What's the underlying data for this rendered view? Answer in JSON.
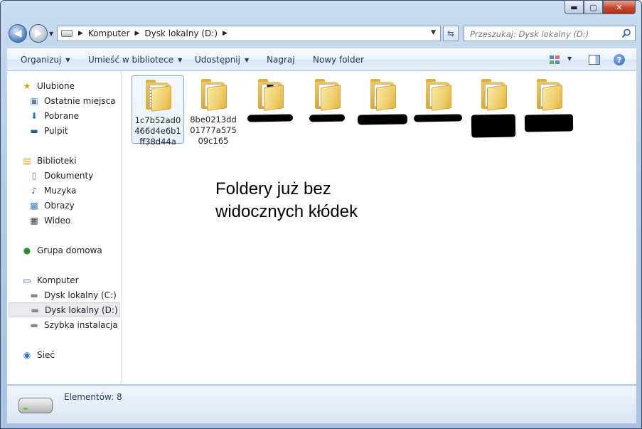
{
  "window": {
    "controls": {
      "minimize": "▬",
      "maximize": "▢",
      "close": "✕"
    }
  },
  "address": {
    "crumbs": [
      "Komputer",
      "Dysk lokalny (D:)"
    ],
    "search_placeholder": "Przeszukaj: Dysk lokalny (D:)"
  },
  "toolbar": {
    "organize": "Organizuj",
    "include_library": "Umieść w bibliotece",
    "share": "Udostępnij",
    "burn": "Nagraj",
    "new_folder": "Nowy folder"
  },
  "nav": {
    "favorites": "Ulubione",
    "recent": "Ostatnie miejsca",
    "downloads": "Pobrane",
    "desktop": "Pulpit",
    "libraries": "Biblioteki",
    "documents": "Dokumenty",
    "music": "Muzyka",
    "pictures": "Obrazy",
    "video": "Wideo",
    "homegroup": "Grupa domowa",
    "computer": "Komputer",
    "drive_c": "Dysk lokalny (C:)",
    "drive_d": "Dysk lokalny (D:)",
    "quick_install": "Szybka instalacja pal",
    "network": "Sieć"
  },
  "files": [
    {
      "name": "1c7b52ad0466d4e6b1ff38d44a",
      "redacted": false
    },
    {
      "name": "8be0213dd01777a57509c165",
      "redacted": false
    },
    {
      "name": "",
      "redacted": true
    },
    {
      "name": "",
      "redacted": true
    },
    {
      "name": "",
      "redacted": true
    },
    {
      "name": "",
      "redacted": true
    },
    {
      "name": "",
      "redacted": true
    },
    {
      "name": "",
      "redacted": true
    }
  ],
  "caption": "Foldery już bez\nwidocznych kłódek",
  "status": {
    "count": "Elementów: 8"
  }
}
